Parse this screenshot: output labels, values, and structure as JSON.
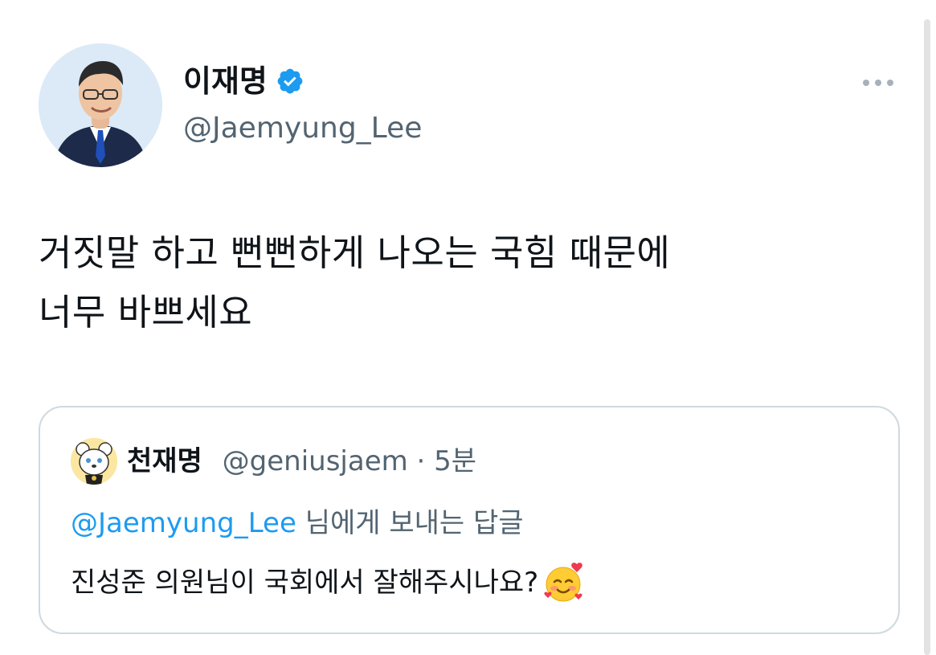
{
  "tweet": {
    "author": {
      "display_name": "이재명",
      "handle": "@Jaemyung_Lee",
      "verified": true,
      "avatar_icon": "profile-photo"
    },
    "more_icon": "ellipsis-icon",
    "text_line1": "거짓말 하고 뻔뻔하게 나오는 국힘 때문에",
    "text_line2": "너무 바쁘세요"
  },
  "quoted_tweet": {
    "author": {
      "display_name": "천재명",
      "handle": "@geniusjaem",
      "separator": " · ",
      "time": "5분",
      "avatar_icon": "bear-avatar"
    },
    "reply_to_handle": "@Jaemyung_Lee",
    "reply_suffix": " 님에게 보내는 답글",
    "text": "진성준 의원님이 국회에서 잘해주시나요?",
    "emoji": "smiling-face-with-hearts"
  },
  "colors": {
    "link_blue": "#1d9bf0",
    "secondary_text": "#536471",
    "primary_text": "#0f1419",
    "card_border": "#cfd9de"
  }
}
